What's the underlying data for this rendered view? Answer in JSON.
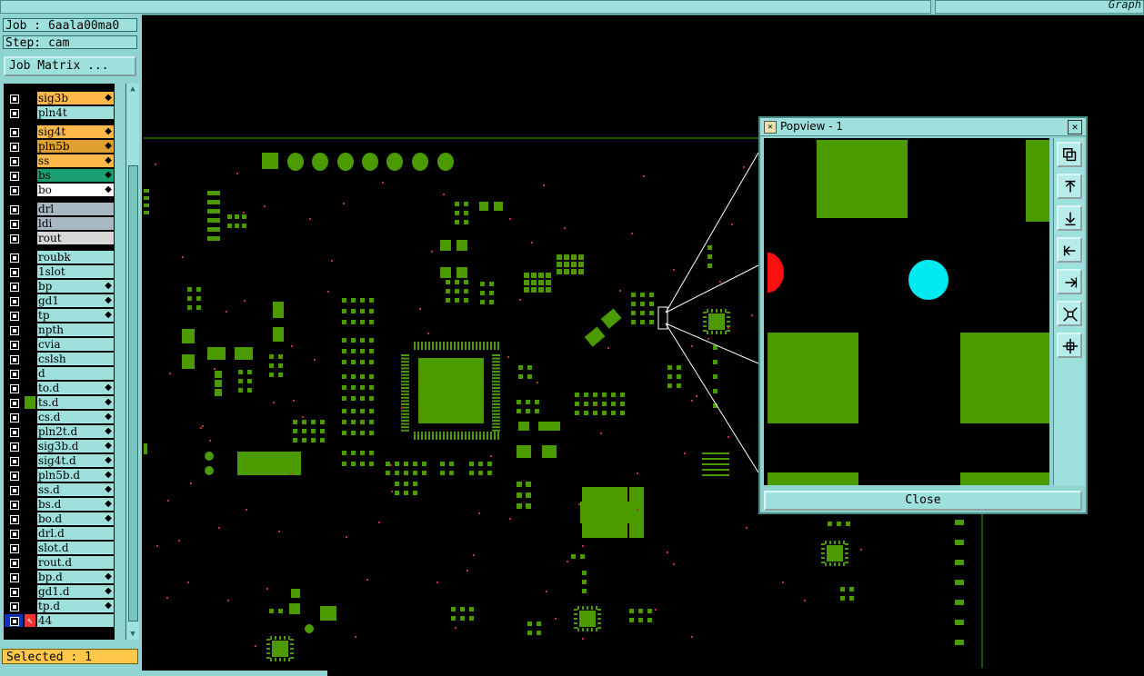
{
  "top_bar": {
    "graph_label": "Graph"
  },
  "left_panel": {
    "job": "Job : 6aala00ma0",
    "step": "Step: cam",
    "job_matrix_button": "Job Matrix ...",
    "layers": [
      {
        "name": "sig3b",
        "color": "#ffb84a",
        "arrow": true
      },
      {
        "name": "pln4t",
        "color": "#9ee0dc",
        "arrow": false
      },
      {
        "name": "sig4t",
        "color": "#ffb84a",
        "arrow": true
      },
      {
        "name": "pln5b",
        "color": "#e0a030",
        "arrow": true
      },
      {
        "name": "ss",
        "color": "#ffb84a",
        "arrow": true
      },
      {
        "name": "bs",
        "color": "#1aa070",
        "arrow": true
      },
      {
        "name": "bo",
        "color": "#ffffff",
        "arrow": true
      },
      {
        "name": "drl",
        "color": "#a8b8c0",
        "arrow": false
      },
      {
        "name": "ldi",
        "color": "#a8b8c0",
        "arrow": false
      },
      {
        "name": "rout",
        "color": "#d8d8d8",
        "arrow": false
      },
      {
        "name": "roubk",
        "color": "#9ee0dc",
        "arrow": false
      },
      {
        "name": "1slot",
        "color": "#9ee0dc",
        "arrow": false
      },
      {
        "name": "bp",
        "color": "#9ee0dc",
        "arrow": true
      },
      {
        "name": "gd1",
        "color": "#9ee0dc",
        "arrow": true
      },
      {
        "name": "tp",
        "color": "#9ee0dc",
        "arrow": true
      },
      {
        "name": "npth",
        "color": "#9ee0dc",
        "arrow": false
      },
      {
        "name": "cvia",
        "color": "#9ee0dc",
        "arrow": false
      },
      {
        "name": "cslsh",
        "color": "#9ee0dc",
        "arrow": false
      },
      {
        "name": "d",
        "color": "#9ee0dc",
        "arrow": false
      },
      {
        "name": "to.d",
        "color": "#9ee0dc",
        "arrow": true
      },
      {
        "name": "ts.d",
        "color": "#9ee0dc",
        "arrow": true,
        "active": true
      },
      {
        "name": "cs.d",
        "color": "#9ee0dc",
        "arrow": true
      },
      {
        "name": "pln2t.d",
        "color": "#9ee0dc",
        "arrow": true
      },
      {
        "name": "sig3b.d",
        "color": "#9ee0dc",
        "arrow": true
      },
      {
        "name": "sig4t.d",
        "color": "#9ee0dc",
        "arrow": true
      },
      {
        "name": "pln5b.d",
        "color": "#9ee0dc",
        "arrow": true
      },
      {
        "name": "ss.d",
        "color": "#9ee0dc",
        "arrow": true
      },
      {
        "name": "bs.d",
        "color": "#9ee0dc",
        "arrow": true
      },
      {
        "name": "bo.d",
        "color": "#9ee0dc",
        "arrow": true
      },
      {
        "name": "drl.d",
        "color": "#9ee0dc",
        "arrow": false
      },
      {
        "name": "slot.d",
        "color": "#9ee0dc",
        "arrow": false
      },
      {
        "name": "rout.d",
        "color": "#9ee0dc",
        "arrow": false
      },
      {
        "name": "bp.d",
        "color": "#9ee0dc",
        "arrow": true
      },
      {
        "name": "gd1.d",
        "color": "#9ee0dc",
        "arrow": true
      },
      {
        "name": "tp.d",
        "color": "#9ee0dc",
        "arrow": true
      },
      {
        "name": "44",
        "color": "#9ee0dc",
        "arrow": false,
        "special": true
      }
    ],
    "selected": "Selected : 1"
  },
  "popview": {
    "title": "Popview - 1",
    "close_button": "Close",
    "tools": [
      "zoom-window-icon",
      "pan-up-icon",
      "pan-down-icon",
      "pan-left-icon",
      "pan-right-icon",
      "fit-icon",
      "center-icon"
    ]
  },
  "colors": {
    "copper": "#4a9a00",
    "drill": "#c03030",
    "highlight": "#00e8f0",
    "marker": "#ff1010",
    "panel": "#8fd4d0"
  }
}
